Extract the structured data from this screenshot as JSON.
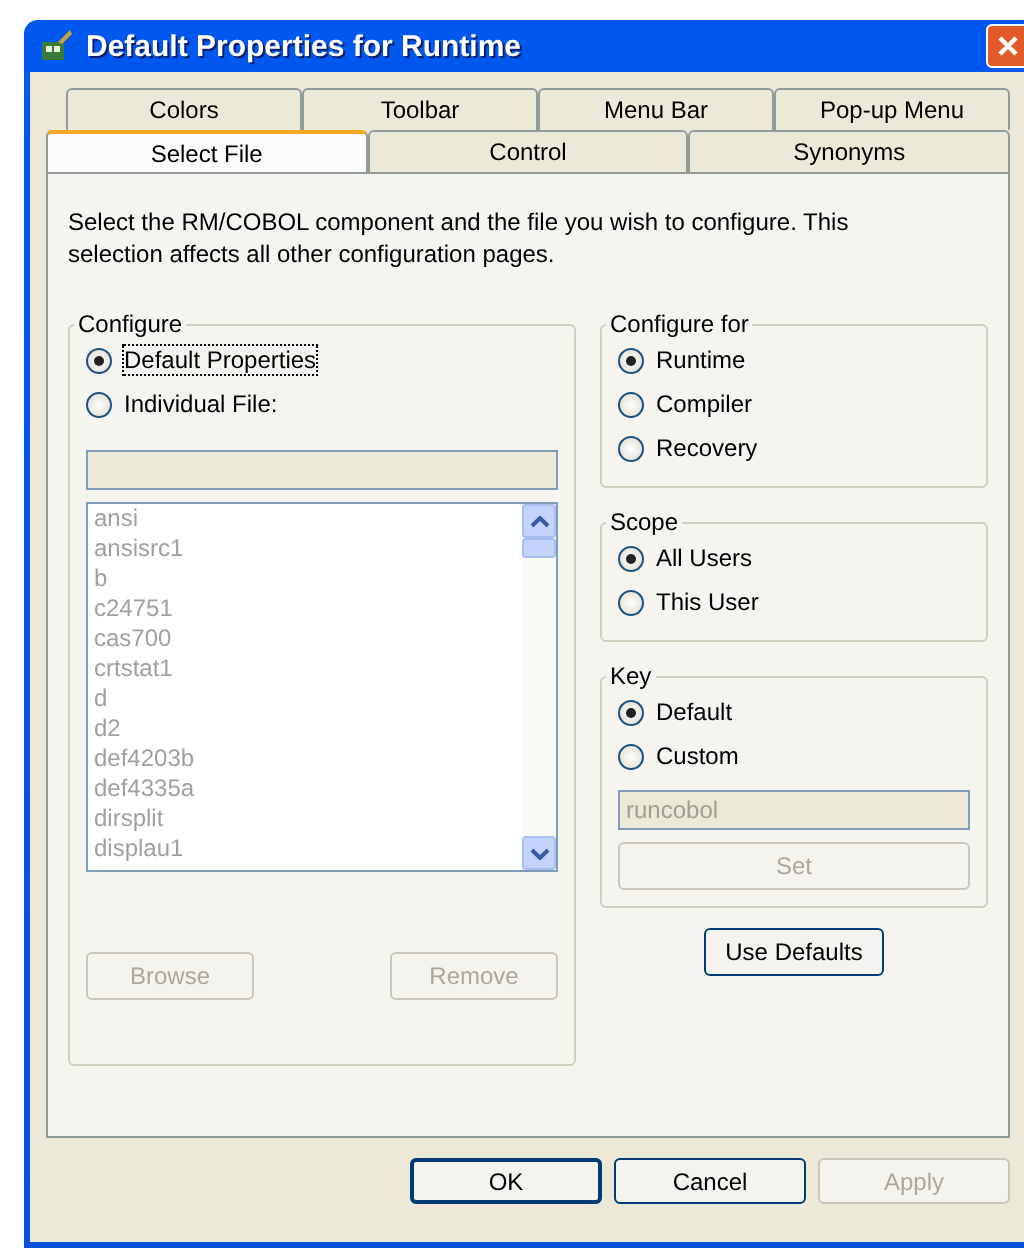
{
  "window": {
    "title": "Default Properties for Runtime"
  },
  "tab_rows": [
    [
      {
        "label": "Colors",
        "selected": false
      },
      {
        "label": "Toolbar",
        "selected": false
      },
      {
        "label": "Menu Bar",
        "selected": false
      },
      {
        "label": "Pop-up Menu",
        "selected": false
      }
    ],
    [
      {
        "label": "Select File",
        "selected": true
      },
      {
        "label": "Control",
        "selected": false
      },
      {
        "label": "Synonyms",
        "selected": false
      }
    ]
  ],
  "description": "Select the RM/COBOL component and the file you wish to configure.  This selection affects all other configuration pages.",
  "configure": {
    "title": "Configure",
    "options": [
      {
        "label": "Default Properties",
        "selected": true,
        "focused": true
      },
      {
        "label": "Individual File:",
        "selected": false,
        "focused": false
      }
    ],
    "file_field": {
      "disabled": true
    },
    "files": {
      "disabled": true,
      "items": [
        "ansi",
        "ansisrc1",
        "b",
        "c24751",
        "cas700",
        "crtstat1",
        "d",
        "d2",
        "def4203b",
        "def4335a",
        "dirsplit",
        "displau1"
      ]
    },
    "buttons": [
      {
        "label": "Browse",
        "disabled": true
      },
      {
        "label": "Remove",
        "disabled": true
      }
    ]
  },
  "configure_for": {
    "title": "Configure for",
    "options": [
      {
        "label": "Runtime",
        "selected": true
      },
      {
        "label": "Compiler",
        "selected": false
      },
      {
        "label": "Recovery",
        "selected": false
      }
    ]
  },
  "scope": {
    "title": "Scope",
    "options": [
      {
        "label": "All Users",
        "selected": true
      },
      {
        "label": "This User",
        "selected": false
      }
    ]
  },
  "key": {
    "title": "Key",
    "options": [
      {
        "label": "Default",
        "selected": true
      },
      {
        "label": "Custom",
        "selected": false
      }
    ],
    "field": {
      "value": "runcobol",
      "disabled": true
    },
    "button": {
      "label": "Set",
      "disabled": true
    }
  },
  "use_defaults": {
    "label": "Use Defaults",
    "disabled": false
  },
  "buttons": [
    {
      "label": "OK",
      "disabled": false,
      "default": true
    },
    {
      "label": "Cancel",
      "disabled": false,
      "default": false
    },
    {
      "label": "Apply",
      "disabled": true,
      "default": false
    }
  ]
}
